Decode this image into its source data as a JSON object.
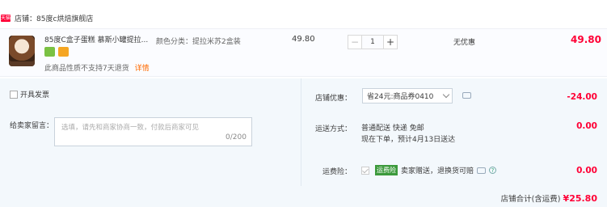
{
  "shop": {
    "badge": "天猫",
    "name": "店铺：85度c烘焙旗舰店"
  },
  "item": {
    "title": "85度C盒子蛋糕 慕斯小罐提拉...",
    "sku": "颜色分类：提拉米苏2盒装",
    "unit_price": "49.80",
    "quantity": "1",
    "discount": "无优惠",
    "total": "49.80",
    "return_note": "此商品性质不支持7天退货",
    "return_detail": "详情"
  },
  "invoice": {
    "label": "开具发票"
  },
  "message": {
    "label": "给卖家留言：",
    "placeholder": "选填，请先和商家协商一致，付款后商家可见",
    "count": "0/200"
  },
  "coupon": {
    "label": "店铺优惠：",
    "selected": "省24元:商品券0410",
    "amount": "-24.00"
  },
  "shipping": {
    "label": "运送方式：",
    "line1": "普通配送 快递 免邮",
    "line2": "现在下单，预计4月13日送达",
    "amount": "0.00"
  },
  "insurance": {
    "label": "运费险：",
    "tag": "运费险",
    "text": "卖家赠送，退换货可赔",
    "help": "?",
    "amount": "0.00"
  },
  "summary": {
    "label": "店铺合计(含运费)",
    "total": "¥25.80"
  }
}
